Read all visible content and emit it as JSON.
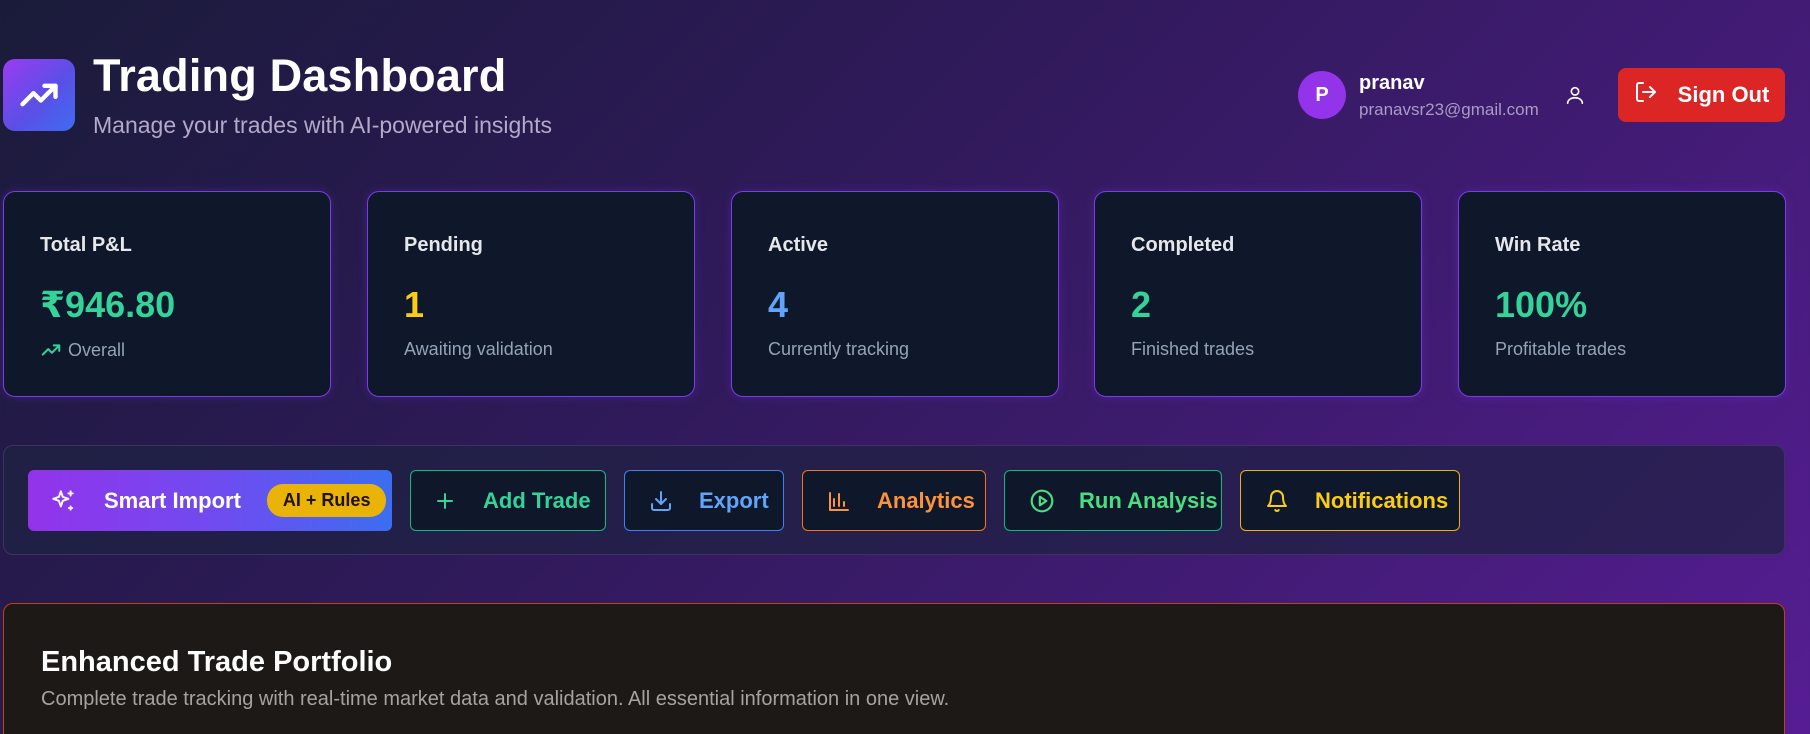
{
  "header": {
    "title": "Trading Dashboard",
    "subtitle": "Manage your trades with AI-powered insights",
    "logo_icon": "trending-up-icon"
  },
  "user": {
    "initial": "P",
    "name": "pranav",
    "email": "pranavsr23@gmail.com",
    "profile_icon": "user-icon",
    "sign_out_label": "Sign Out",
    "sign_out_icon": "log-out-icon"
  },
  "stats": [
    {
      "label": "Total P&L",
      "value": "₹946.80",
      "sub": "Overall",
      "color": "#34d399",
      "sub_icon": "trending-up-icon"
    },
    {
      "label": "Pending",
      "value": "1",
      "sub": "Awaiting validation",
      "color": "#facc15"
    },
    {
      "label": "Active",
      "value": "4",
      "sub": "Currently tracking",
      "color": "#60a5fa"
    },
    {
      "label": "Completed",
      "value": "2",
      "sub": "Finished trades",
      "color": "#34d399"
    },
    {
      "label": "Win Rate",
      "value": "100%",
      "sub": "Profitable trades",
      "color": "#34d399"
    }
  ],
  "actions": {
    "smart_import": {
      "label": "Smart Import",
      "badge": "AI + Rules",
      "icon": "sparkles-icon"
    },
    "add_trade": {
      "label": "Add Trade",
      "icon": "plus-icon",
      "color": "#34d399"
    },
    "export": {
      "label": "Export",
      "icon": "download-icon",
      "color": "#60a5fa"
    },
    "analytics": {
      "label": "Analytics",
      "icon": "bar-chart-icon",
      "color": "#fb923c"
    },
    "run_analysis": {
      "label": "Run Analysis",
      "icon": "play-circle-icon",
      "color": "#4ade80"
    },
    "notifications": {
      "label": "Notifications",
      "icon": "bell-icon",
      "color": "#facc15"
    }
  },
  "portfolio": {
    "title": "Enhanced Trade Portfolio",
    "description": "Complete trade tracking with real-time market data and validation. All essential information in one view."
  }
}
